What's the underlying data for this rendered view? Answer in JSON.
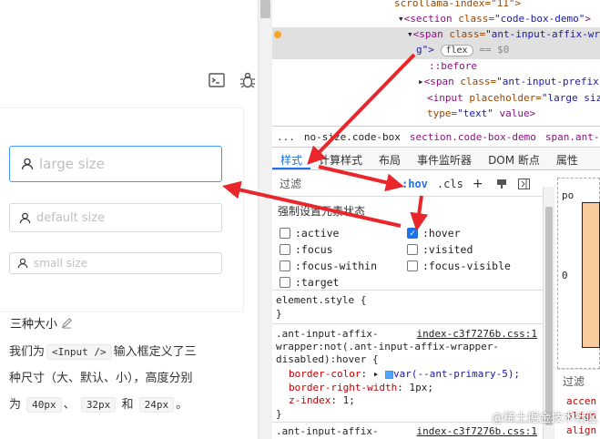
{
  "left": {
    "inputs": {
      "large": "large size",
      "default": "default size",
      "small": "small size"
    },
    "section_title": "三种大小",
    "desc_line1_pre": "我们为",
    "desc_code1": "<Input />",
    "desc_line1_post": "输入框定义了三",
    "desc_line2": "种尺寸（大、默认、小），高度分别",
    "desc_line3_pre": "为",
    "desc_code2": "40px",
    "desc_sep1": "、",
    "desc_code3": "32px",
    "desc_sep2": "和",
    "desc_code4": "24px",
    "desc_end": "。"
  },
  "devtools": {
    "elements": {
      "line1": "scrollama-index=\"11\">",
      "line2_tag": "<section ",
      "line2_attr": "class=",
      "line2_val": "\"code-box-demo\"",
      "line2_end": ">",
      "line3_tag": "<span ",
      "line3_attr": "class=",
      "line3_val": "\"ant-input-affix-wr",
      "line4_val": "g\">",
      "line4_badge": "flex",
      "line4_eq": "== $0",
      "line5": "::before",
      "line6_tag": "<span ",
      "line6_attr": "class=",
      "line6_val": "\"ant-input-prefix",
      "line7_tag": "<input ",
      "line7_attr": "placeholder=",
      "line7_val": "\"large siz",
      "line8_attr": "type=",
      "line8_val": "\"text\"",
      "line8_end": " value>"
    },
    "breadcrumb": {
      "dots": "...",
      "item1": "no-size.code-box",
      "item2": "section.code-box-demo",
      "item3": "span.ant-input-a"
    },
    "tabs": [
      "样式",
      "计算样式",
      "布局",
      "事件监听器",
      "DOM 断点",
      "属性"
    ],
    "filter_label": "过滤",
    "hov": ":hov",
    "cls": ".cls",
    "plus": "+",
    "states_title": "强制设置元素状态",
    "states": {
      "active": ":active",
      "hover": ":hover",
      "focus": ":focus",
      "visited": ":visited",
      "focus_within": ":focus-within",
      "focus_visible": ":focus-visible",
      "target": ":target"
    },
    "rules": {
      "element_style": "element.style {",
      "close1": "}",
      "sel1a": ".ant-input-affix-",
      "src1": "index-c3f7276b.css:1",
      "sel1b": "wrapper:not(.ant-input-affix-wrapper-",
      "sel1c": "disabled):hover {",
      "p1": "border-color",
      "v1": "var(--ant-primary-5);",
      "p2": "border-right-width",
      "v2": "1px;",
      "p3": "z-index",
      "v3": "1;",
      "close2": "}",
      "sel2a": ".ant-input-affix-",
      "src2": "index-c3f7276b.css:1"
    },
    "computed_filter": "过滤",
    "computed_lines": [
      "accen",
      "align",
      "align"
    ],
    "box_label": "po",
    "box_zero": "0"
  },
  "watermark": "@稀土掘金技术社区"
}
